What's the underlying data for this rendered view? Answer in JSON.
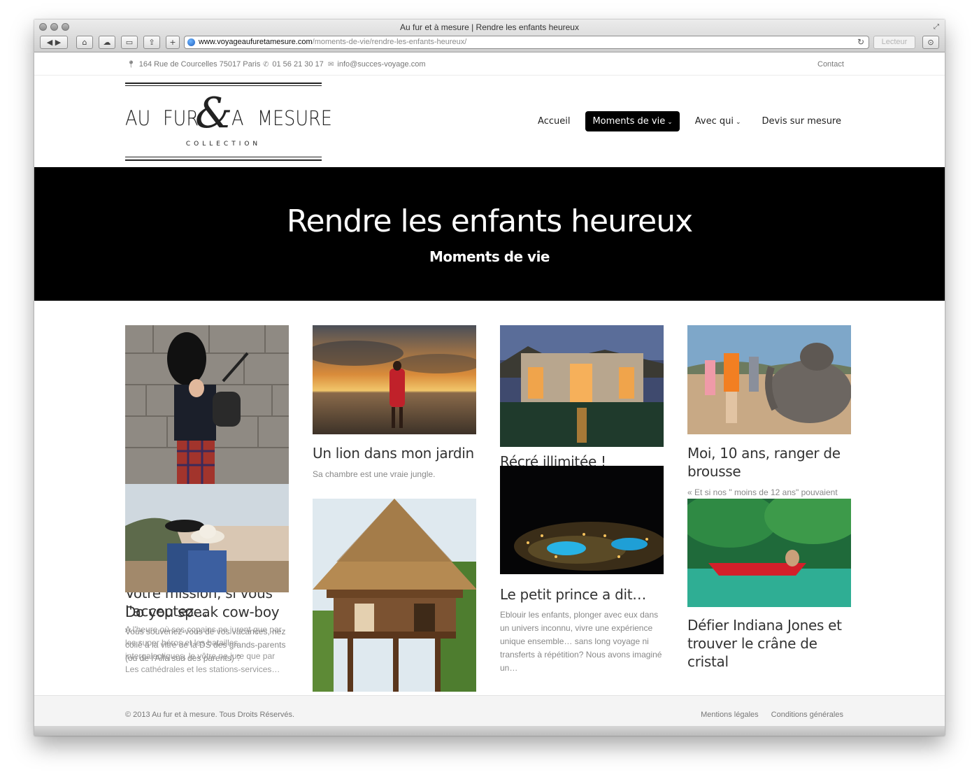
{
  "browser": {
    "window_title": "Au fur et à mesure | Rendre les enfants heureux",
    "url_domain": "www.voyageaufuretamesure.com",
    "url_path": "/moments-de-vie/rendre-les-enfants-heureux/",
    "reader_label": "Lecteur"
  },
  "topbar": {
    "address": "164 Rue de Courcelles 75017 Paris",
    "phone": "01 56 21 30 17",
    "email": "info@succes-voyage.com",
    "contact_label": "Contact"
  },
  "logo": {
    "word_left_1": "AU",
    "word_left_2": "FUR",
    "ampersand": "&",
    "word_right_1": "A",
    "word_right_2": "MESURE",
    "subtitle": "COLLECTION"
  },
  "nav": {
    "items": [
      {
        "label": "Accueil"
      },
      {
        "label": "Moments de vie"
      },
      {
        "label": "Avec qui"
      },
      {
        "label": "Devis sur mesure"
      }
    ]
  },
  "hero": {
    "title": "Rendre les enfants heureux",
    "subtitle": "Moments de vie"
  },
  "cards": [
    {
      "title": "Un lion dans mon jardin",
      "excerpt": "Sa chambre est une vraie jungle."
    },
    {
      "title": "Récré illimitée !",
      "excerpt": ""
    },
    {
      "title": "Moi, 10 ans, ranger de brousse",
      "excerpt": "« Et si nos \" moins de 12 ans\" pouvaient"
    },
    {
      "title": "Votre mission, si vous l'acceptez…",
      "excerpt": "A l'heure où ses copains ne jurent que par les super héros et les batailles intergalactiques, le vôtre ne jure que par Les cathédrales et les stations-services…"
    },
    {
      "title": "Do you speak cow-boy",
      "excerpt": "Vous souvenez-vous de vos vacances, nez collé à la vitre de la DS des grands-parents (ou de l'Alfa sud des parents) ?"
    },
    {
      "title": "Le petit prince a dit…",
      "excerpt": "Eblouir les enfants, plonger avec eux dans un univers inconnu, vivre une expérience unique ensemble… sans long voyage ni transferts à répétition? Nous avons imaginé un…"
    },
    {
      "title": "Défier Indiana Jones et trouver le crâne de cristal",
      "excerpt": ""
    }
  ],
  "footer": {
    "copyright": "© 2013 Au fur et à mesure. Tous Droits Réservés.",
    "links": [
      {
        "label": "Mentions légales"
      },
      {
        "label": "Conditions générales"
      }
    ]
  }
}
